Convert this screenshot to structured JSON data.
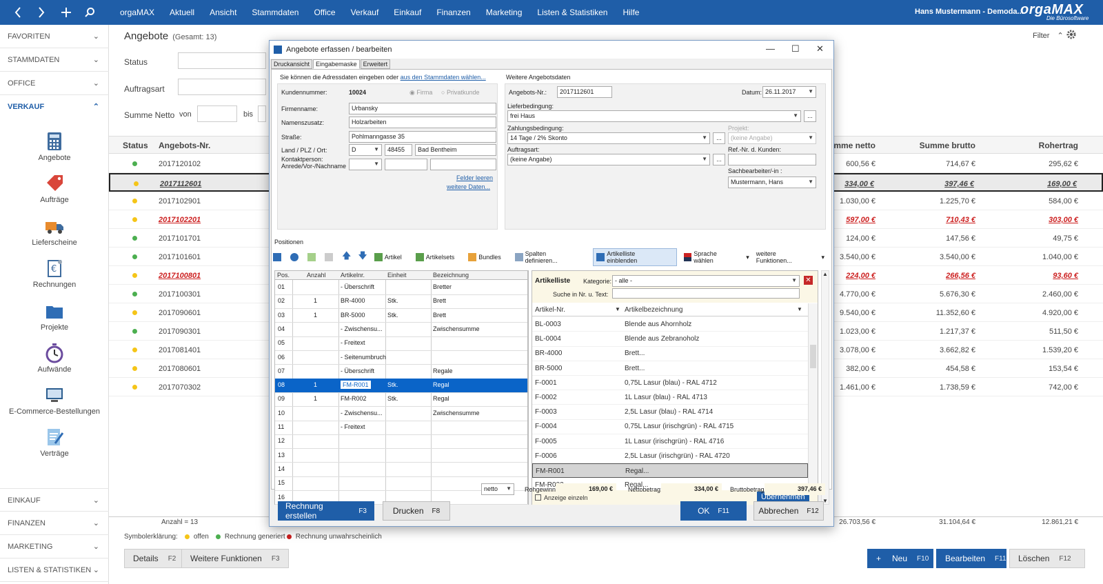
{
  "topbar": {
    "menu": [
      "orgaMAX",
      "Aktuell",
      "Ansicht",
      "Stammdaten",
      "Office",
      "Verkauf",
      "Einkauf",
      "Finanzen",
      "Marketing",
      "Listen & Statistiken",
      "Hilfe"
    ],
    "user": "Hans Mustermann - Demoda...",
    "logo": "orgaMAX",
    "logo_sub": "Die Bürosoftware"
  },
  "sidebar": {
    "sections_top": [
      "FAVORITEN",
      "STAMMDATEN",
      "OFFICE",
      "VERKAUF"
    ],
    "items": [
      "Angebote",
      "Aufträge",
      "Lieferscheine",
      "Rechnungen",
      "Projekte",
      "Aufwände",
      "E-Commerce-Bestellungen",
      "Verträge"
    ],
    "sections_bottom": [
      "EINKAUF",
      "FINANZEN",
      "MARKETING",
      "LISTEN & STATISTIKEN"
    ]
  },
  "main": {
    "title": "Angebote",
    "subtitle": "(Gesamt: 13)",
    "filter_label": "Filter",
    "status_label": "Status",
    "auftragsart_label": "Auftragsart",
    "summe_label": "Summe Netto",
    "von": "von",
    "bis": "bis",
    "columns": [
      "Status",
      "Angebots-Nr.",
      "Summe netto",
      "Summe brutto",
      "Rohertrag"
    ],
    "rows": [
      {
        "nr": "2017120102",
        "netto": "600,56 €",
        "brutto": "714,67 €",
        "roh": "295,62 €",
        "color": "#4caf50",
        "style": ""
      },
      {
        "nr": "2017112601",
        "netto": "334,00 €",
        "brutto": "397,46 €",
        "roh": "169,00 €",
        "color": "#f5c518",
        "style": "sel"
      },
      {
        "nr": "2017102901",
        "netto": "1.030,00 €",
        "brutto": "1.225,70 €",
        "roh": "584,00 €",
        "color": "#f5c518",
        "style": ""
      },
      {
        "nr": "2017102201",
        "netto": "597,00 €",
        "brutto": "710,43 €",
        "roh": "303,00 €",
        "color": "#f5c518",
        "style": "red"
      },
      {
        "nr": "2017101701",
        "netto": "124,00 €",
        "brutto": "147,56 €",
        "roh": "49,75 €",
        "color": "#4caf50",
        "style": ""
      },
      {
        "nr": "2017101601",
        "netto": "3.540,00 €",
        "brutto": "3.540,00 €",
        "roh": "1.040,00 €",
        "color": "#4caf50",
        "style": ""
      },
      {
        "nr": "2017100801",
        "netto": "224,00 €",
        "brutto": "266,56 €",
        "roh": "93,60 €",
        "color": "#f5c518",
        "style": "red"
      },
      {
        "nr": "2017100301",
        "netto": "4.770,00 €",
        "brutto": "5.676,30 €",
        "roh": "2.460,00 €",
        "color": "#4caf50",
        "style": ""
      },
      {
        "nr": "2017090601",
        "netto": "9.540,00 €",
        "brutto": "11.352,60 €",
        "roh": "4.920,00 €",
        "color": "#f5c518",
        "style": ""
      },
      {
        "nr": "2017090301",
        "netto": "1.023,00 €",
        "brutto": "1.217,37 €",
        "roh": "511,50 €",
        "color": "#4caf50",
        "style": ""
      },
      {
        "nr": "2017081401",
        "netto": "3.078,00 €",
        "brutto": "3.662,82 €",
        "roh": "1.539,20 €",
        "color": "#f5c518",
        "style": ""
      },
      {
        "nr": "2017080601",
        "netto": "382,00 €",
        "brutto": "454,58 €",
        "roh": "153,54 €",
        "color": "#f5c518",
        "style": ""
      },
      {
        "nr": "2017070302",
        "netto": "1.461,00 €",
        "brutto": "1.738,59 €",
        "roh": "742,00 €",
        "color": "#f5c518",
        "style": ""
      }
    ],
    "anzahl": "Anzahl = 13",
    "totals": {
      "netto": "26.703,56 €",
      "brutto": "31.104,64 €",
      "roh": "12.861,21 €"
    },
    "legend_label": "Symbolerklärung:",
    "legend": [
      {
        "label": "offen",
        "color": "#f5c518"
      },
      {
        "label": "Rechnung generiert",
        "color": "#4caf50"
      },
      {
        "label": "Rechnung unwahrscheinlich",
        "color": "#cc1f1f"
      }
    ],
    "buttons": {
      "details": "Details",
      "details_key": "F2",
      "weitere": "Weitere Funktionen",
      "weitere_key": "F3",
      "neu": "Neu",
      "neu_key": "F10",
      "bearbeiten": "Bearbeiten",
      "bearbeiten_key": "F11",
      "loeschen": "Löschen",
      "loeschen_key": "F12"
    }
  },
  "dialog": {
    "title": "Angebote erfassen / bearbeiten",
    "tabs": [
      "Druckansicht",
      "Eingabemaske",
      "Erweitert"
    ],
    "adress_hint": "Sie können die Adressdaten eingeben oder",
    "adress_link": "aus den Stammdaten wählen...",
    "kundennummer_label": "Kundennummer:",
    "kundennummer": "10024",
    "firma": "Firma",
    "privatkunde": "Privatkunde",
    "firmenname_label": "Firmenname:",
    "firmenname": "Urbansky",
    "namenszusatz_label": "Namenszusatz:",
    "namenszusatz": "Holzarbeiten",
    "strasse_label": "Straße:",
    "strasse": "Pohlmanngasse 35",
    "land_label": "Land / PLZ / Ort:",
    "land": "D",
    "plz": "48455",
    "ort": "Bad Bentheim",
    "kontakt_label1": "Kontaktperson:",
    "kontakt_label2": "Anrede/Vor-/Nachname",
    "felder_leeren": "Felder leeren",
    "weitere_daten": "weitere Daten...",
    "weitere_angebotsdaten": "Weitere Angebotsdaten",
    "angebotsnr_label": "Angebots-Nr.:",
    "angebotsnr": "2017112601",
    "datum_label": "Datum:",
    "datum": "26.11.2017",
    "lieferbedingung_label": "Lieferbedingung:",
    "lieferbedingung": "frei Haus",
    "zahlungsbedingung_label": "Zahlungsbedingung:",
    "zahlungsbedingung": "14 Tage / 2% Skonto",
    "projekt_label": "Projekt:",
    "projekt": "(keine Angabe)",
    "auftragsart_label": "Auftragsart:",
    "auftragsart": "(keine Angabe)",
    "refnr_label": "Ref.-Nr. d. Kunden:",
    "sachbearbeiter_label": "Sachbearbeiter/-in :",
    "sachbearbeiter": "Mustermann, Hans",
    "positionen_label": "Positionen",
    "toolbar": [
      "Artikel",
      "Artikelsets",
      "Bundles",
      "Spalten definieren...",
      "Artikelliste einblenden",
      "Sprache wählen",
      "weitere Funktionen..."
    ],
    "pos_columns": [
      "Pos.",
      "Anzahl",
      "Artikelnr.",
      "Einheit",
      "Bezeichnung"
    ],
    "positions": [
      {
        "pos": "01",
        "anzahl": "",
        "art": "- Überschrift",
        "einheit": "",
        "bez": "Bretter"
      },
      {
        "pos": "02",
        "anzahl": "1",
        "art": "BR-4000",
        "einheit": "Stk.",
        "bez": "Brett"
      },
      {
        "pos": "03",
        "anzahl": "1",
        "art": "BR-5000",
        "einheit": "Stk.",
        "bez": "Brett"
      },
      {
        "pos": "04",
        "anzahl": "",
        "art": "- Zwischensu...",
        "einheit": "",
        "bez": "Zwischensumme"
      },
      {
        "pos": "05",
        "anzahl": "",
        "art": "- Freitext",
        "einheit": "",
        "bez": ""
      },
      {
        "pos": "06",
        "anzahl": "",
        "art": "- Seitenumbruch",
        "einheit": "",
        "bez": ""
      },
      {
        "pos": "07",
        "anzahl": "",
        "art": "- Überschrift",
        "einheit": "",
        "bez": "Regale"
      },
      {
        "pos": "08",
        "anzahl": "1",
        "art": "FM-R001",
        "einheit": "Stk.",
        "bez": "Regal"
      },
      {
        "pos": "09",
        "anzahl": "1",
        "art": "FM-R002",
        "einheit": "Stk.",
        "bez": "Regal"
      },
      {
        "pos": "10",
        "anzahl": "",
        "art": "- Zwischensu...",
        "einheit": "",
        "bez": "Zwischensumme"
      },
      {
        "pos": "11",
        "anzahl": "",
        "art": "- Freitext",
        "einheit": "",
        "bez": ""
      },
      {
        "pos": "12",
        "anzahl": "",
        "art": "",
        "einheit": "",
        "bez": ""
      },
      {
        "pos": "13",
        "anzahl": "",
        "art": "",
        "einheit": "",
        "bez": ""
      },
      {
        "pos": "14",
        "anzahl": "",
        "art": "",
        "einheit": "",
        "bez": ""
      },
      {
        "pos": "15",
        "anzahl": "",
        "art": "",
        "einheit": "",
        "bez": ""
      },
      {
        "pos": "16",
        "anzahl": "",
        "art": "",
        "einheit": "",
        "bez": ""
      }
    ],
    "artikelliste": {
      "title": "Artikelliste",
      "kategorie_label": "Kategorie:",
      "kategorie": "- alle -",
      "suche_label": "Suche in Nr. u. Text:",
      "col1": "Artikel-Nr.",
      "col2": "Artikelbezeichnung",
      "items": [
        {
          "nr": "BL-0003",
          "bez": "Blende aus Ahornholz"
        },
        {
          "nr": "BL-0004",
          "bez": "Blende aus Zebranoholz"
        },
        {
          "nr": "BR-4000",
          "bez": "Brett..."
        },
        {
          "nr": "BR-5000",
          "bez": "Brett..."
        },
        {
          "nr": "F-0001",
          "bez": "0,75L Lasur (blau) - RAL 4712"
        },
        {
          "nr": "F-0002",
          "bez": "1L Lasur (blau) - RAL 4713"
        },
        {
          "nr": "F-0003",
          "bez": "2,5L Lasur (blau) - RAL 4714"
        },
        {
          "nr": "F-0004",
          "bez": "0,75L Lasur (irischgrün) - RAL 4715"
        },
        {
          "nr": "F-0005",
          "bez": "1L Lasur (irischgrün) - RAL 4716"
        },
        {
          "nr": "F-0006",
          "bez": "2,5L Lasur (irischgrün) - RAL 4720"
        },
        {
          "nr": "FM-R001",
          "bez": "Regal..."
        },
        {
          "nr": "FM-R002",
          "bez": "Regal..."
        }
      ],
      "anzeige": "Anzeige einzeln",
      "uebernehmen": "Übernehmen"
    },
    "netto_select": "netto",
    "rohgewinn_label": "Rohgewinn:",
    "rohgewinn": "169,00 €",
    "nettobetrag_label": "Nettobetrag:",
    "nettobetrag": "334,00 €",
    "bruttobetrag_label": "Bruttobetrag:",
    "bruttobetrag": "397,46 €",
    "btn_rechnung": "Rechnung erstellen",
    "btn_rechnung_key": "F3",
    "btn_drucken": "Drucken",
    "btn_drucken_key": "F8",
    "btn_ok": "OK",
    "btn_ok_key": "F11",
    "btn_abbrechen": "Abbrechen",
    "btn_abbrechen_key": "F12"
  }
}
